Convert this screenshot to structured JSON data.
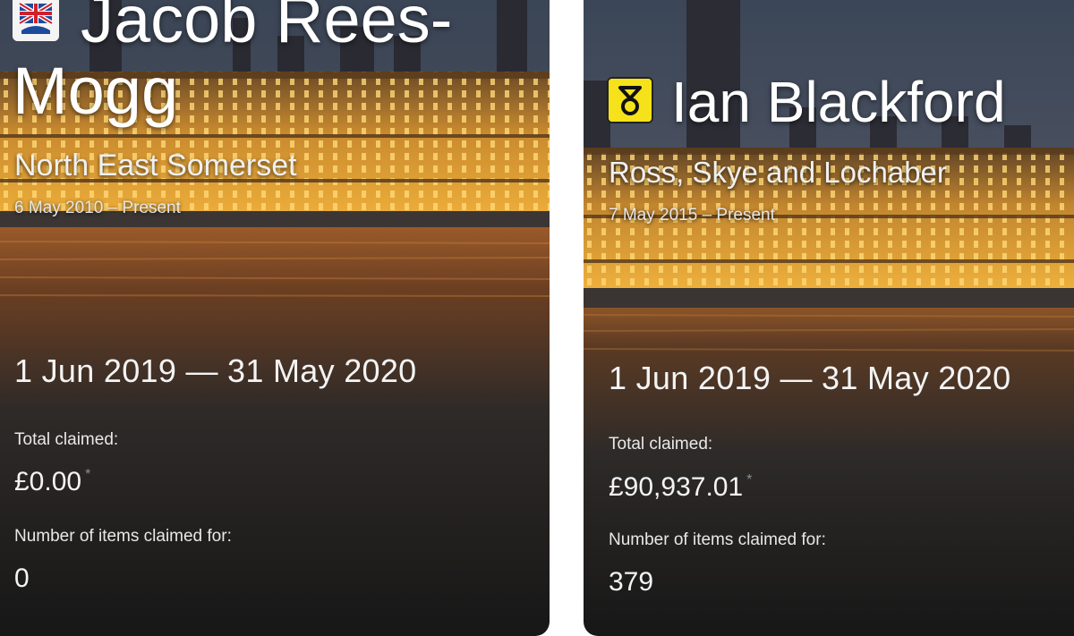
{
  "cards": [
    {
      "party": "conservative",
      "party_icon": "union-flag-tree-icon",
      "name": "Jacob Rees-Mogg",
      "constituency": "North East Somerset",
      "tenure": "6 May 2010 – Present",
      "period": "1 Jun 2019 — 31 May 2020",
      "total_claimed_label": "Total claimed:",
      "total_claimed_value": "£0.00",
      "asterisk": "*",
      "items_label": "Number of items claimed for:",
      "items_value": "0"
    },
    {
      "party": "snp",
      "party_icon": "snp-logo-icon",
      "name": "Ian Blackford",
      "constituency": "Ross, Skye and Lochaber",
      "tenure": "7 May 2015 – Present",
      "period": "1 Jun 2019 — 31 May 2020",
      "total_claimed_label": "Total claimed:",
      "total_claimed_value": "£90,937.01",
      "asterisk": "*",
      "items_label": "Number of items claimed for:",
      "items_value": "379"
    }
  ],
  "colors": {
    "background": "#ffffff",
    "conservative_blue": "#1d4b9c",
    "conservative_red": "#d0202a",
    "snp_yellow": "#f5e21a",
    "building_glow": "#e8a534"
  }
}
